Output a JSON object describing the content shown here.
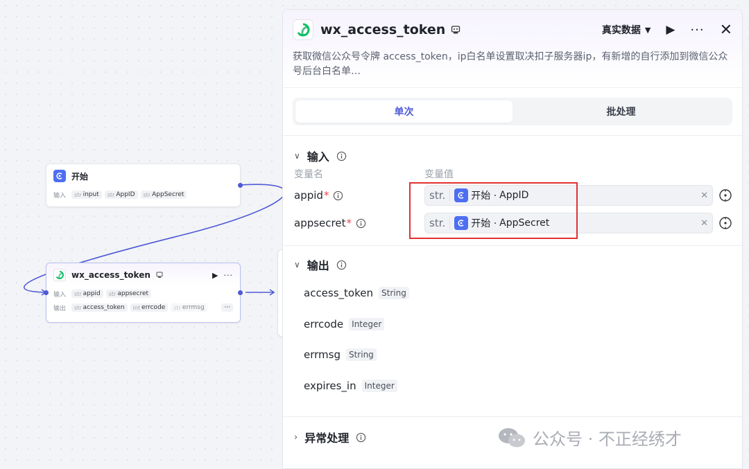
{
  "canvas": {
    "start_node": {
      "title": "开始",
      "row_label": "输入",
      "params": [
        {
          "type": "str",
          "name": "input"
        },
        {
          "type": "str",
          "name": "AppID"
        },
        {
          "type": "str",
          "name": "AppSecret"
        }
      ]
    },
    "token_node": {
      "title": "wx_access_token",
      "input_label": "输入",
      "inputs": [
        {
          "type": "str",
          "name": "appid"
        },
        {
          "type": "str",
          "name": "appsecret"
        }
      ],
      "output_label": "输出",
      "outputs": [
        {
          "type": "str",
          "name": "access_token"
        },
        {
          "type": "int",
          "name": "errcode"
        },
        {
          "type": "str",
          "name": "errmsg"
        }
      ],
      "more": "···"
    }
  },
  "panel": {
    "title": "wx_access_token",
    "real_data_label": "真实数据",
    "description": "获取微信公众号令牌 access_token，ip白名单设置取决扣子服务器ip，有新增的自行添加到微信公众号后台白名单…",
    "tabs": [
      {
        "label": "单次",
        "active": true
      },
      {
        "label": "批处理",
        "active": false
      }
    ],
    "input_section": {
      "title": "输入",
      "col_name": "变量名",
      "col_value": "变量值",
      "params": [
        {
          "name": "appid",
          "required": "*",
          "type": "str.",
          "ref_prefix": "开始 · ",
          "ref_value": "AppID"
        },
        {
          "name": "appsecret",
          "required": "*",
          "type": "str.",
          "ref_prefix": "开始 · ",
          "ref_value": "AppSecret"
        }
      ]
    },
    "output_section": {
      "title": "输出",
      "fields": [
        {
          "name": "access_token",
          "type": "String"
        },
        {
          "name": "errcode",
          "type": "Integer"
        },
        {
          "name": "errmsg",
          "type": "String"
        },
        {
          "name": "expires_in",
          "type": "Integer"
        }
      ]
    },
    "exception_section": {
      "title": "异常处理"
    }
  },
  "watermark": {
    "text": "公众号 · 不正经绣才"
  },
  "colors": {
    "accent": "#4e5ad6",
    "start_icon": "#4e6ef2",
    "highlight": "#e03131",
    "wechat_green": "#07c160"
  }
}
